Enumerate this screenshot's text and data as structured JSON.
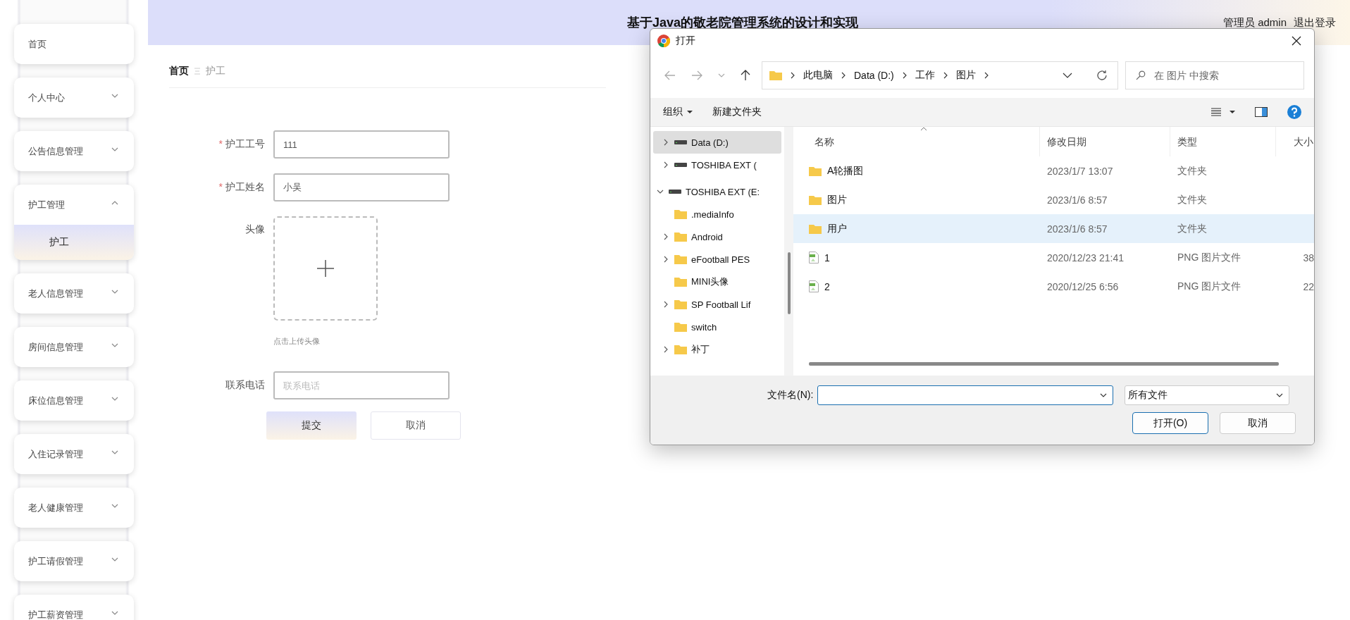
{
  "sidebar": {
    "items": [
      {
        "label": "首页",
        "expandable": false
      },
      {
        "label": "个人中心",
        "expandable": true,
        "expanded": false
      },
      {
        "label": "公告信息管理",
        "expandable": true,
        "expanded": false
      },
      {
        "label": "护工管理",
        "expandable": true,
        "expanded": true,
        "children": [
          {
            "label": "护工",
            "selected": true
          }
        ]
      },
      {
        "label": "老人信息管理",
        "expandable": true,
        "expanded": false
      },
      {
        "label": "房间信息管理",
        "expandable": true,
        "expanded": false
      },
      {
        "label": "床位信息管理",
        "expandable": true,
        "expanded": false
      },
      {
        "label": "入住记录管理",
        "expandable": true,
        "expanded": false
      },
      {
        "label": "老人健康管理",
        "expandable": true,
        "expanded": false
      },
      {
        "label": "护工请假管理",
        "expandable": true,
        "expanded": false
      },
      {
        "label": "护工薪资管理",
        "expandable": true,
        "expanded": false
      }
    ]
  },
  "header": {
    "title": "基于Java的敬老院管理系统的设计和实现",
    "user": "管理员 admin",
    "logout": "退出登录"
  },
  "breadcrumb": [
    "首页",
    "护工"
  ],
  "form": {
    "fields": [
      {
        "kind": "text",
        "label": "护工工号",
        "required_mark": "*",
        "value": "111"
      },
      {
        "kind": "text",
        "label": "护工姓名",
        "required_mark": "*",
        "value": "小吴"
      },
      {
        "kind": "upload",
        "label": "头像",
        "hint": "点击上传头像"
      },
      {
        "kind": "text",
        "label": "联系电话",
        "placeholder": "联系电话"
      }
    ],
    "buttons": [
      {
        "label": "提交",
        "kind": "primary"
      },
      {
        "label": "取消",
        "kind": "plain"
      }
    ]
  },
  "dialog": {
    "title": "打开",
    "path": [
      "此电脑",
      "Data (D:)",
      "工作",
      "图片"
    ],
    "search_placeholder": "在 图片 中搜索",
    "toolbar": [
      "组织",
      "新建文件夹"
    ],
    "tree": [
      {
        "label": "Data (D:)",
        "kind": "drive",
        "has_children": true,
        "expanded": false,
        "selected": true
      },
      {
        "label": "TOSHIBA EXT (",
        "kind": "drive",
        "has_children": true,
        "expanded": false,
        "selected": false
      },
      {
        "label": "TOSHIBA EXT (E:",
        "kind": "drive",
        "has_children": true,
        "expanded": true,
        "selected": false,
        "children": [
          {
            "label": ".mediaInfo",
            "kind": "folder",
            "has_children": false,
            "expanded": false,
            "selected": false
          },
          {
            "label": "Android",
            "kind": "folder",
            "has_children": true,
            "expanded": false,
            "selected": false
          },
          {
            "label": "eFootball PES",
            "kind": "folder",
            "has_children": true,
            "expanded": false,
            "selected": false
          },
          {
            "label": "MINI头像",
            "kind": "folder",
            "has_children": false,
            "expanded": false,
            "selected": false
          },
          {
            "label": "SP Football Lif",
            "kind": "folder",
            "has_children": true,
            "expanded": false,
            "selected": false
          },
          {
            "label": "switch",
            "kind": "folder",
            "has_children": false,
            "expanded": false,
            "selected": false
          },
          {
            "label": "补丁",
            "kind": "folder",
            "has_children": true,
            "expanded": false,
            "selected": false
          }
        ]
      }
    ],
    "columns": [
      "名称",
      "修改日期",
      "类型",
      "大小"
    ],
    "files": [
      {
        "name": "A轮播图",
        "date": "2023/1/7 13:07",
        "type": "文件夹",
        "kind": "folder",
        "selected": false
      },
      {
        "name": "图片",
        "date": "2023/1/6 8:57",
        "type": "文件夹",
        "kind": "folder",
        "selected": false
      },
      {
        "name": "用户",
        "date": "2023/1/6 8:57",
        "type": "文件夹",
        "kind": "folder",
        "selected": true
      },
      {
        "name": "1",
        "date": "2020/12/23 21:41",
        "type": "PNG 图片文件",
        "size": "38",
        "kind": "png",
        "selected": false
      },
      {
        "name": "2",
        "date": "2020/12/25 6:56",
        "type": "PNG 图片文件",
        "size": "22",
        "kind": "png",
        "selected": false
      }
    ],
    "filename_label": "文件名(N):",
    "filetype": "所有文件",
    "buttons": [
      {
        "label": "打开(O)",
        "kind": "default"
      },
      {
        "label": "取消",
        "kind": "plain"
      }
    ]
  }
}
